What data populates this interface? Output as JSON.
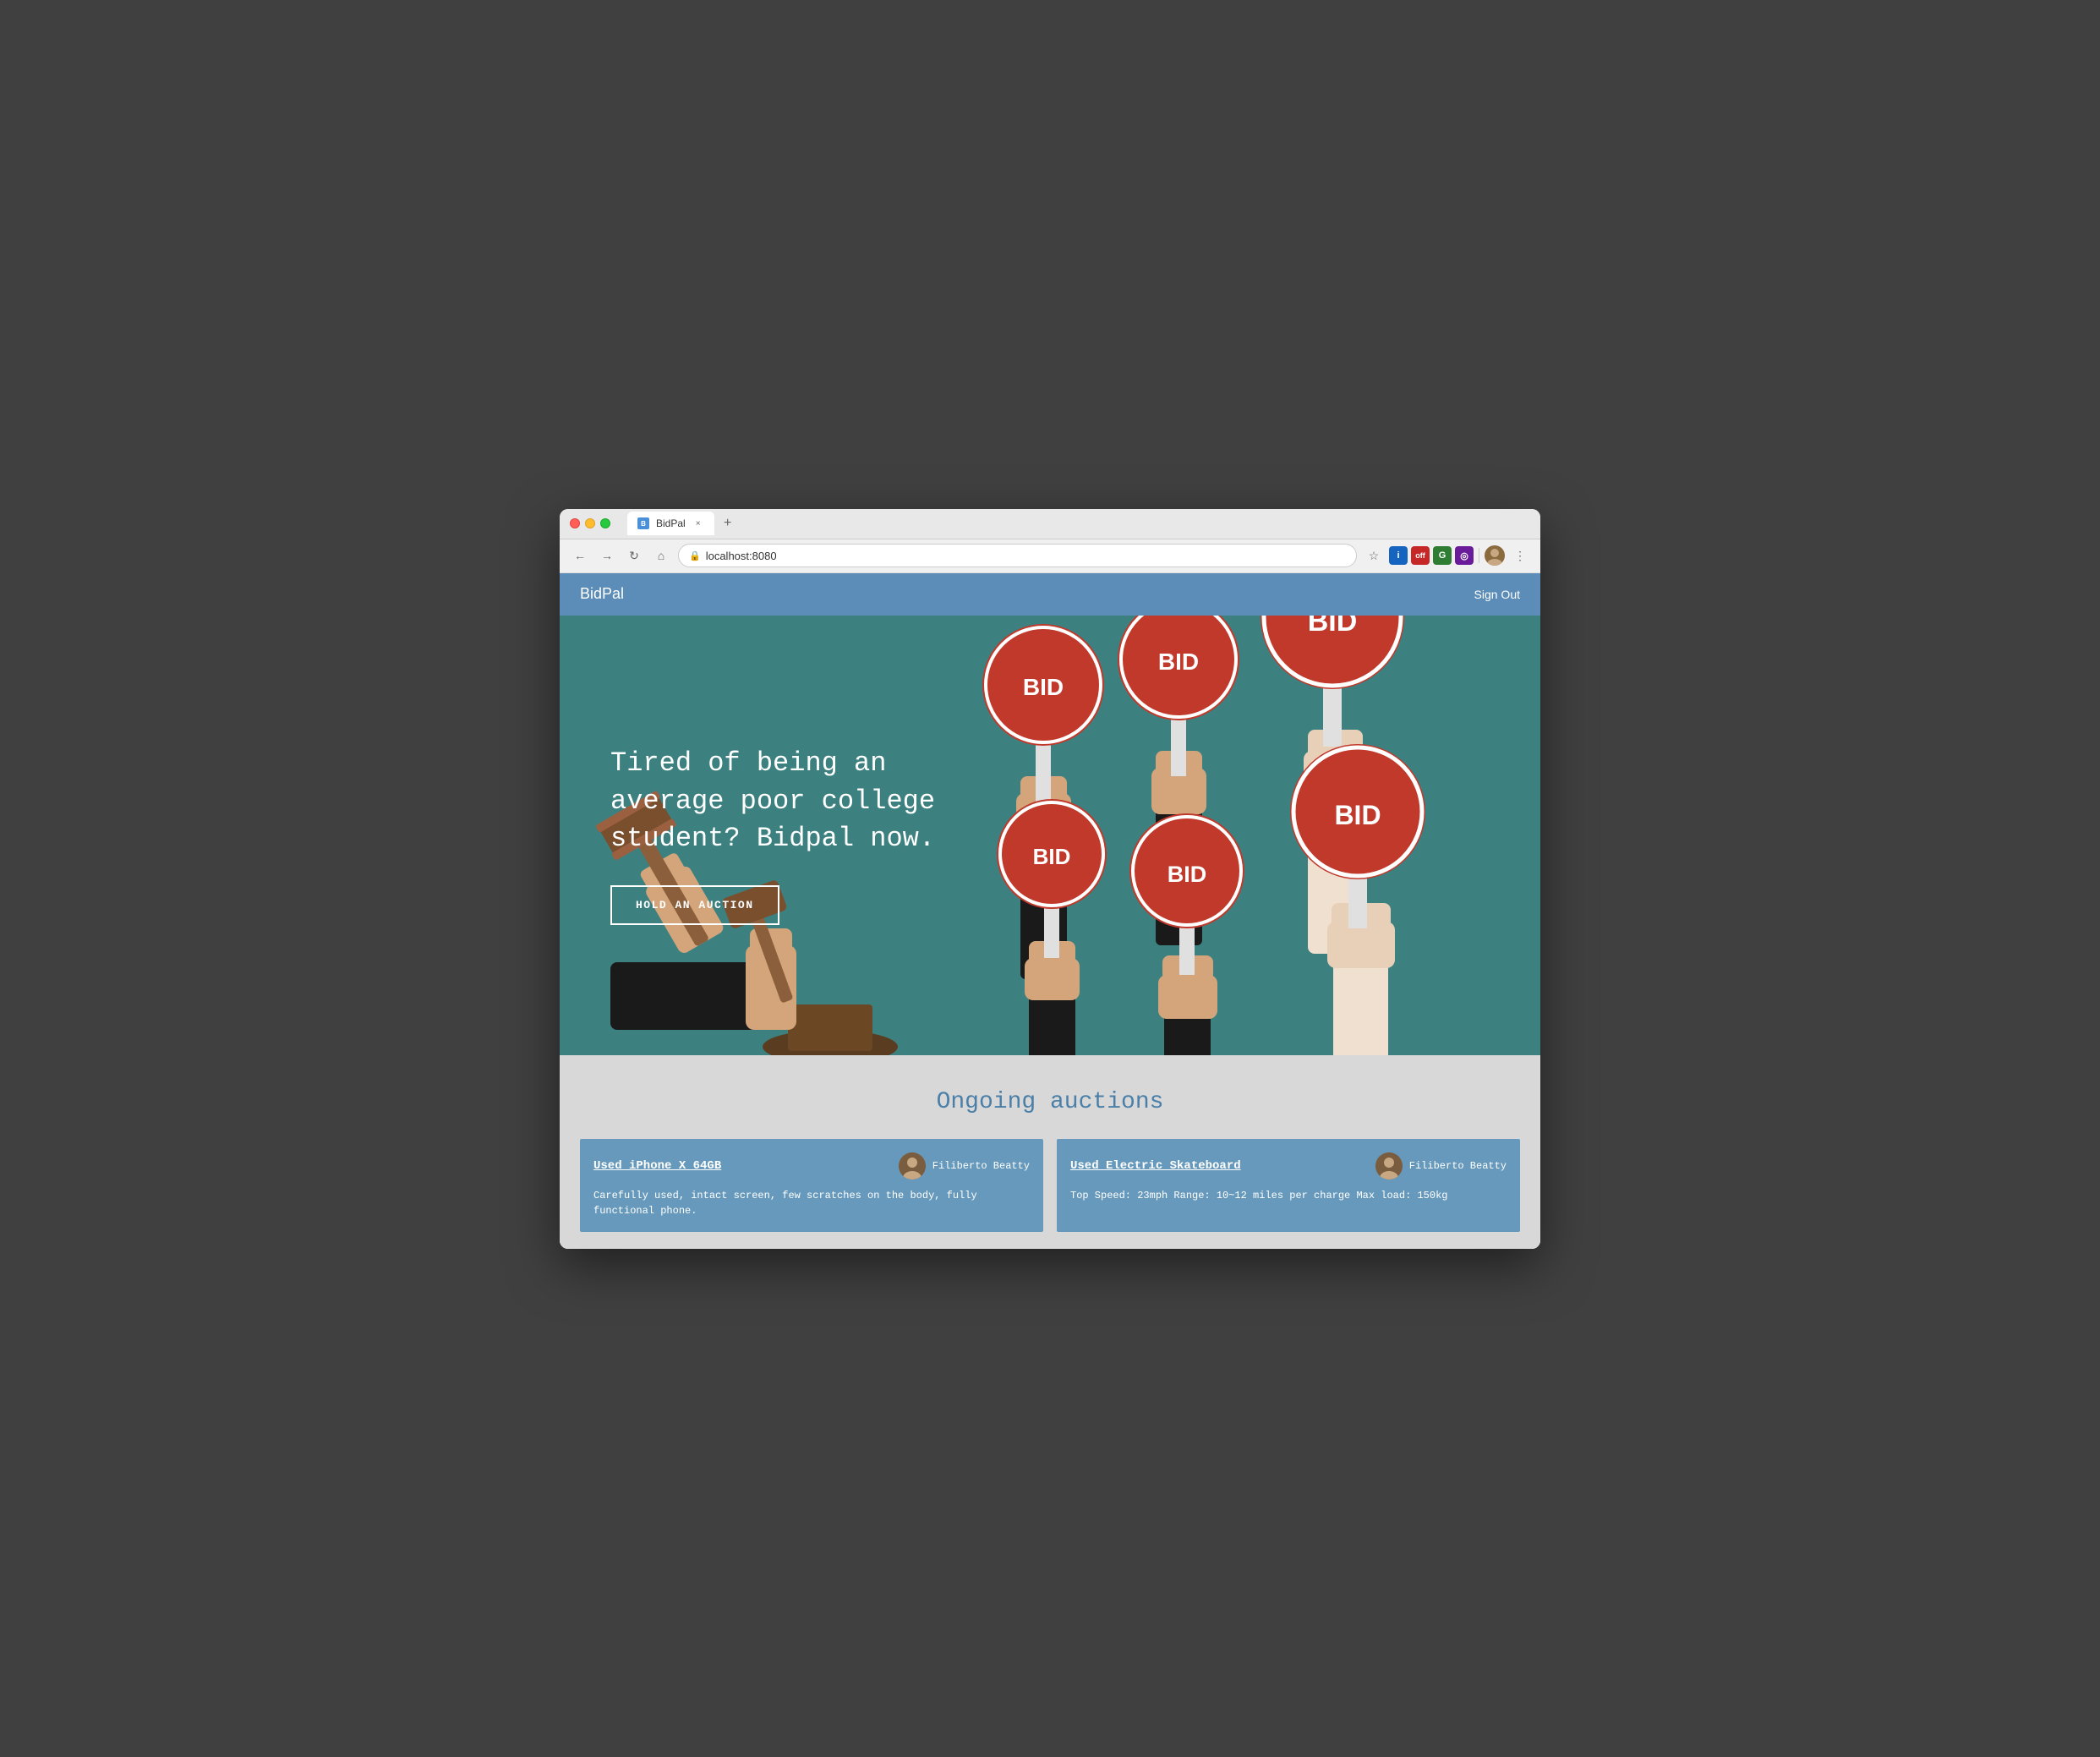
{
  "browser": {
    "tab_title": "BidPal",
    "url": "localhost:8080",
    "new_tab_label": "+",
    "close_tab_label": "×"
  },
  "nav": {
    "brand": "BidPal",
    "sign_out": "Sign Out"
  },
  "hero": {
    "title": "Tired of being an average poor college student? Bidpal now.",
    "cta_label": "HOLD AN AUCTION"
  },
  "auctions_section": {
    "title": "Ongoing auctions",
    "cards": [
      {
        "title": "Used iPhone X 64GB",
        "seller": "Filiberto Beatty",
        "description": "Carefully used, intact screen, few scratches on the body, fully functional phone."
      },
      {
        "title": "Used Electric Skateboard",
        "seller": "Filiberto Beatty",
        "description": "Top Speed: 23mph Range: 10~12 miles per charge Max load: 150kg"
      }
    ]
  },
  "icons": {
    "lock": "🔒",
    "star": "☆",
    "menu": "⋮",
    "back": "←",
    "forward": "→",
    "reload": "↻",
    "home": "⌂"
  }
}
